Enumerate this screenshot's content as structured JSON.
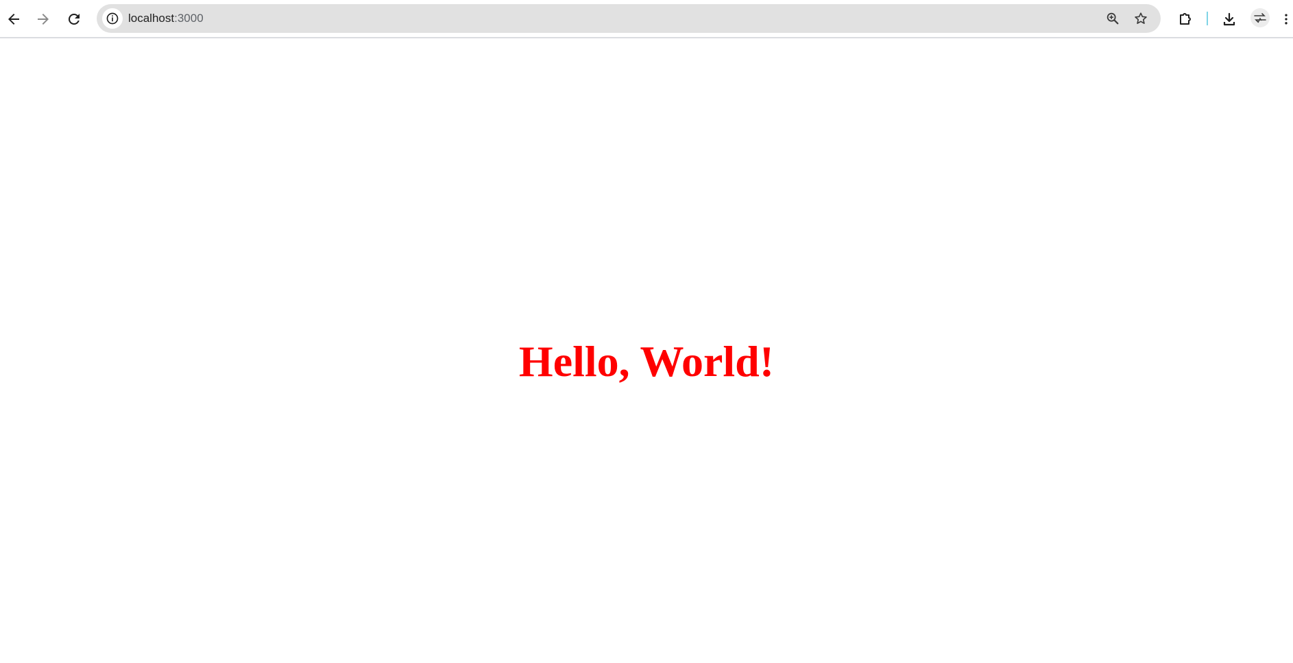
{
  "browser": {
    "url_host": "localhost",
    "url_port": ":3000"
  },
  "icons": {
    "back": "arrow-back-icon",
    "forward": "arrow-forward-icon",
    "reload": "reload-icon",
    "site_info": "info-icon",
    "zoom": "zoom-in-icon",
    "bookmark": "star-icon",
    "extensions": "puzzle-icon",
    "downloads": "download-icon",
    "profile": "profile-avatar-icon",
    "menu": "kebab-menu-icon"
  },
  "page": {
    "heading": "Hello, World!",
    "heading_color": "#ff0000"
  }
}
